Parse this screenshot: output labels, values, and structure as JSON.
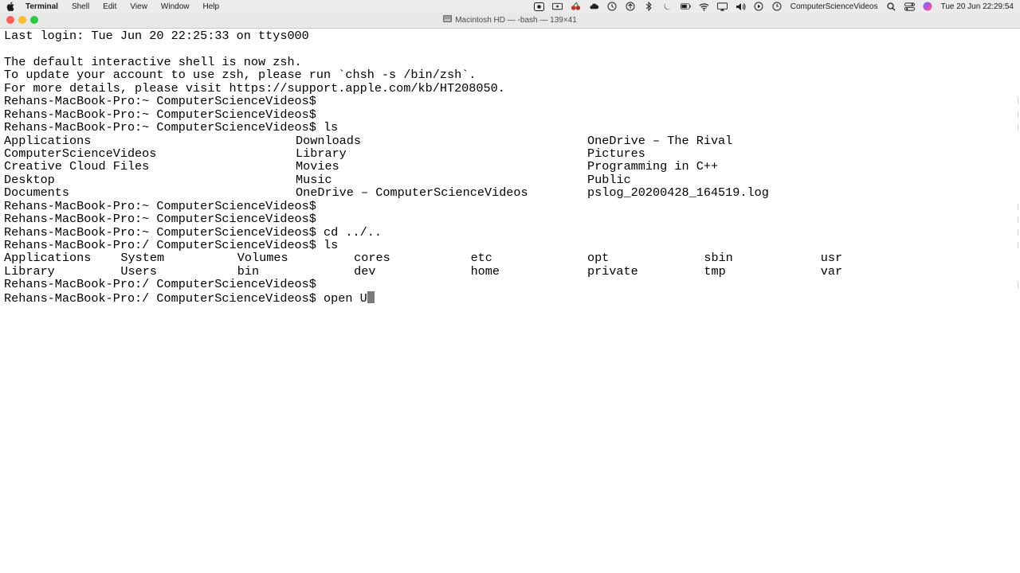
{
  "menubar": {
    "app_name": "Terminal",
    "items": [
      "Shell",
      "Edit",
      "View",
      "Window",
      "Help"
    ],
    "status_icons": [
      "screen-record-icon",
      "display-icon",
      "cherry-icon",
      "cloud-icon",
      "time-machine-icon",
      "upload-icon",
      "bluetooth-icon",
      "moon-icon",
      "battery-icon",
      "wifi-icon",
      "airplay-icon",
      "volume-icon",
      "play-icon",
      "clock-icon"
    ],
    "user": "ComputerScienceVideos",
    "datetime": "Tue 20 Jun  22:29:54"
  },
  "window": {
    "title": "Macintosh HD — -bash — 139×41"
  },
  "terminal": {
    "lines_top": [
      "Last login: Tue Jun 20 22:25:33 on ttys000",
      "",
      "The default interactive shell is now zsh.",
      "To update your account to use zsh, please run `chsh -s /bin/zsh`.",
      "For more details, please visit https://support.apple.com/kb/HT208050.",
      "Rehans-MacBook-Pro:~ ComputerScienceVideos$",
      "Rehans-MacBook-Pro:~ ComputerScienceVideos$",
      "Rehans-MacBook-Pro:~ ComputerScienceVideos$ ls"
    ],
    "ls_home": [
      [
        "Applications",
        "Downloads",
        "OneDrive – The Rival"
      ],
      [
        "ComputerScienceVideos",
        "Library",
        "Pictures"
      ],
      [
        "Creative Cloud Files",
        "Movies",
        "Programming in C++"
      ],
      [
        "Desktop",
        "Music",
        "Public"
      ],
      [
        "Documents",
        "OneDrive – ComputerScienceVideos",
        "pslog_20200428_164519.log"
      ]
    ],
    "lines_mid": [
      "Rehans-MacBook-Pro:~ ComputerScienceVideos$",
      "Rehans-MacBook-Pro:~ ComputerScienceVideos$",
      "Rehans-MacBook-Pro:~ ComputerScienceVideos$ cd ../..",
      "Rehans-MacBook-Pro:/ ComputerScienceVideos$ ls"
    ],
    "ls_root": [
      [
        "Applications",
        "System",
        "Volumes",
        "cores",
        "etc",
        "opt",
        "sbin",
        "usr"
      ],
      [
        "Library",
        "Users",
        "bin",
        "dev",
        "home",
        "private",
        "tmp",
        "var"
      ]
    ],
    "lines_bottom": [
      "Rehans-MacBook-Pro:/ ComputerScienceVideos$"
    ],
    "current_prompt": "Rehans-MacBook-Pro:/ ComputerScienceVideos$ open U"
  }
}
